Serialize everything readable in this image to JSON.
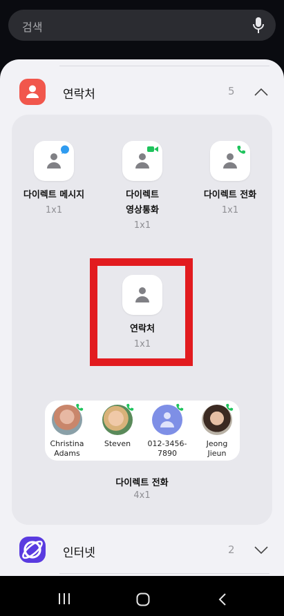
{
  "search": {
    "placeholder": "검색",
    "mic_icon": "microphone-icon"
  },
  "contacts_group": {
    "title": "연락처",
    "count": "5",
    "icon": "contacts-app-icon",
    "accent": "#f1574c",
    "widgets": [
      {
        "name": "다이렉트 메시지",
        "size": "1x1",
        "badge": "message-icon",
        "badge_color": "#2f9bf0"
      },
      {
        "name_line1": "다이렉트",
        "name_line2": "영상통화",
        "size": "1x1",
        "badge": "video-call-icon",
        "badge_color": "#1ec35c"
      },
      {
        "name": "다이렉트 전화",
        "size": "1x1",
        "badge": "phone-icon",
        "badge_color": "#1ec35c"
      },
      {
        "name": "연락처",
        "size": "1x1",
        "highlighted": true
      }
    ],
    "direct_call_4x1": {
      "name": "다이렉트 전화",
      "size": "4x1",
      "contacts": [
        {
          "line1": "Christina",
          "line2": "Adams"
        },
        {
          "line1": "Steven",
          "line2": ""
        },
        {
          "line1": "012-3456-",
          "line2": "7890"
        },
        {
          "line1": "Jeong",
          "line2": "Jieun"
        }
      ]
    }
  },
  "internet_group": {
    "title": "인터넷",
    "count": "2",
    "icon": "internet-app-icon",
    "accent": "#5a3be0"
  },
  "nav": {
    "recents": "recents-icon",
    "home": "home-icon",
    "back": "back-icon"
  }
}
